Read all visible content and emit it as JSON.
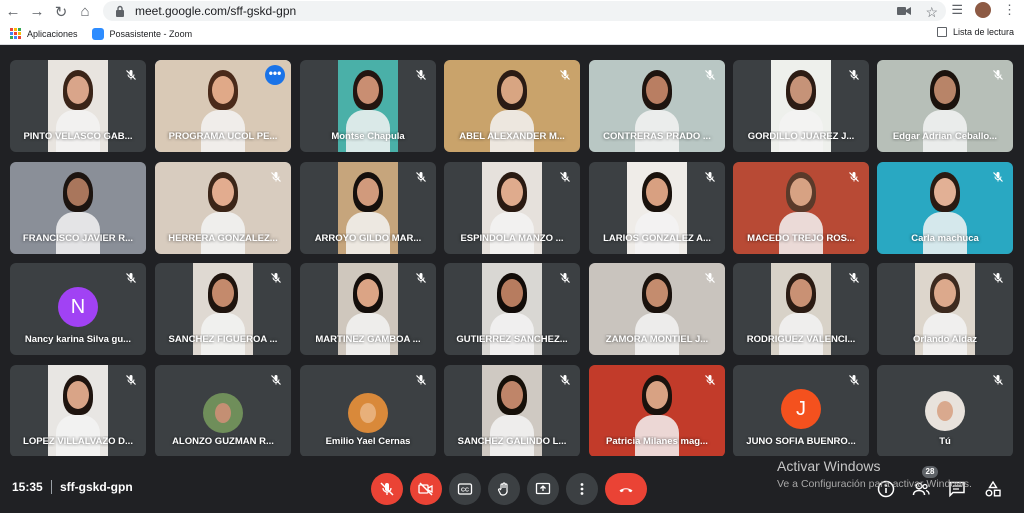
{
  "browser": {
    "url": "meet.google.com/sff-gskd-gpn",
    "bookmarks": [
      {
        "label": "Aplicaciones",
        "icon": "apps-grid-icon"
      },
      {
        "label": "Posasistente - Zoom",
        "icon": "zoom-icon"
      }
    ],
    "reading_list": "Lista de lectura"
  },
  "meeting": {
    "time": "15:35",
    "code": "sff-gskd-gpn",
    "participant_count": "28"
  },
  "watermark": {
    "title": "Activar Windows",
    "subtitle": "Ve a Configuración para activar Windows."
  },
  "tiles": [
    {
      "name": "PINTO VELASCO GAB...",
      "muted": true
    },
    {
      "name": "PROGRAMA UCOL PE...",
      "muted": false,
      "active": true
    },
    {
      "name": "Montse Chapula",
      "muted": true
    },
    {
      "name": "ABEL ALEXANDER M...",
      "muted": true
    },
    {
      "name": "CONTRERAS PRADO ...",
      "muted": true
    },
    {
      "name": "GORDILLO JUAREZ J...",
      "muted": true
    },
    {
      "name": "Edgar Adrian Ceballo...",
      "muted": true
    },
    {
      "name": "FRANCISCO JAVIER R...",
      "muted": false
    },
    {
      "name": "HERRERA GONZALEZ...",
      "muted": true
    },
    {
      "name": "ARROYO GILDO MAR...",
      "muted": true
    },
    {
      "name": "ESPINDOLA MANZO ...",
      "muted": true
    },
    {
      "name": "LARIOS GONZALEZ A...",
      "muted": true
    },
    {
      "name": "MACEDO TREJO ROS...",
      "muted": true
    },
    {
      "name": "Carla machuca",
      "muted": true
    },
    {
      "name": "Nancy karina Silva gu...",
      "muted": true,
      "initial": "N",
      "avatar_color": "#a142f4"
    },
    {
      "name": "SANCHEZ FIGUEROA ...",
      "muted": true
    },
    {
      "name": "MARTINEZ GAMBOA ...",
      "muted": true
    },
    {
      "name": "GUTIERREZ SANCHEZ...",
      "muted": true
    },
    {
      "name": "ZAMORA MONTIEL J...",
      "muted": true
    },
    {
      "name": "RODRIGUEZ VALENCI...",
      "muted": true
    },
    {
      "name": "Orlando Aldaz",
      "muted": true
    },
    {
      "name": "LOPEZ VILLALVAZO D...",
      "muted": true
    },
    {
      "name": "ALONZO GUZMAN R...",
      "muted": true
    },
    {
      "name": "Emilio Yael Cernas",
      "muted": true
    },
    {
      "name": "SANCHEZ GALINDO L...",
      "muted": true
    },
    {
      "name": "Patricia Milanes mag...",
      "muted": true
    },
    {
      "name": "JUNO SOFIA BUENRO...",
      "muted": true,
      "initial": "J",
      "avatar_color": "#f4511e"
    },
    {
      "name": "Tú",
      "muted": true
    }
  ],
  "controls": [
    "microphone-off",
    "camera-off",
    "captions",
    "raise-hand",
    "present-screen",
    "more-options",
    "leave-call"
  ],
  "colors": {
    "accent": "#8ab4f8",
    "danger": "#ea4335",
    "tile": "#3c4043",
    "background": "#202124"
  }
}
